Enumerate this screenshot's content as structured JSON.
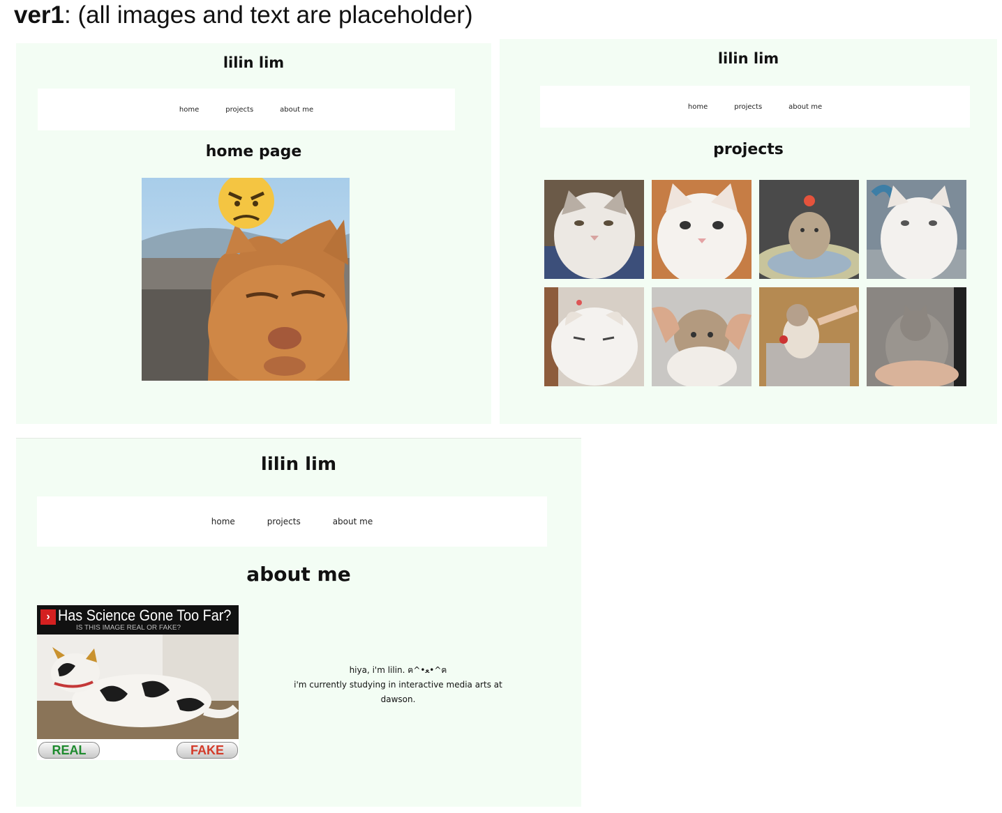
{
  "heading": {
    "bold": "ver1",
    "rest": ": (all images and text are placeholder)"
  },
  "colors": {
    "panel_bg": "#f3fdf4",
    "nav_bg": "#ffffff",
    "meme_real": "#1e8a2e",
    "meme_fake": "#d33b2a"
  },
  "home_panel": {
    "site_title": "lilin lim",
    "nav": [
      "home",
      "projects",
      "about me"
    ],
    "page_heading": "home page",
    "image": "photo of an orange cat with an angry face emoji"
  },
  "projects_panel": {
    "site_title": "lilin lim",
    "nav": [
      "home",
      "projects",
      "about me"
    ],
    "page_heading": "projects",
    "gallery_count": 8
  },
  "about_panel": {
    "site_title": "lilin lim",
    "nav": [
      "home",
      "projects",
      "about me"
    ],
    "page_heading": "about me",
    "meme": {
      "title": "Has Science Gone Too Far?",
      "subtitle": "IS THIS IMAGE REAL OR FAKE?",
      "real_label": "REAL",
      "fake_label": "FAKE"
    },
    "bio": [
      "hiya, i'm lilin. ฅ^•ﻌ•^ฅ",
      "i'm currently studying in interactive media arts at",
      "dawson."
    ]
  }
}
